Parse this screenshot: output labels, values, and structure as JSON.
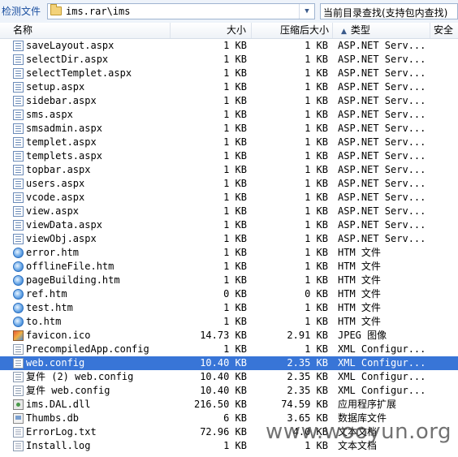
{
  "toolbar": {
    "detect_label": "检测文件",
    "path": "ims.rar\\ims",
    "search_placeholder": "当前目录查找(支持包内查找)"
  },
  "columns": {
    "name": "名称",
    "size": "大小",
    "compressed": "压缩后大小",
    "type": "类型",
    "security": "安全"
  },
  "files": [
    {
      "name": "saveLayout.aspx",
      "size": "1 KB",
      "compressed": "1 KB",
      "type": "ASP.NET Serv...",
      "icon": "aspx-file-icon"
    },
    {
      "name": "selectDir.aspx",
      "size": "1 KB",
      "compressed": "1 KB",
      "type": "ASP.NET Serv...",
      "icon": "aspx-file-icon"
    },
    {
      "name": "selectTemplet.aspx",
      "size": "1 KB",
      "compressed": "1 KB",
      "type": "ASP.NET Serv...",
      "icon": "aspx-file-icon"
    },
    {
      "name": "setup.aspx",
      "size": "1 KB",
      "compressed": "1 KB",
      "type": "ASP.NET Serv...",
      "icon": "aspx-file-icon"
    },
    {
      "name": "sidebar.aspx",
      "size": "1 KB",
      "compressed": "1 KB",
      "type": "ASP.NET Serv...",
      "icon": "aspx-file-icon"
    },
    {
      "name": "sms.aspx",
      "size": "1 KB",
      "compressed": "1 KB",
      "type": "ASP.NET Serv...",
      "icon": "aspx-file-icon"
    },
    {
      "name": "smsadmin.aspx",
      "size": "1 KB",
      "compressed": "1 KB",
      "type": "ASP.NET Serv...",
      "icon": "aspx-file-icon"
    },
    {
      "name": "templet.aspx",
      "size": "1 KB",
      "compressed": "1 KB",
      "type": "ASP.NET Serv...",
      "icon": "aspx-file-icon"
    },
    {
      "name": "templets.aspx",
      "size": "1 KB",
      "compressed": "1 KB",
      "type": "ASP.NET Serv...",
      "icon": "aspx-file-icon"
    },
    {
      "name": "topbar.aspx",
      "size": "1 KB",
      "compressed": "1 KB",
      "type": "ASP.NET Serv...",
      "icon": "aspx-file-icon"
    },
    {
      "name": "users.aspx",
      "size": "1 KB",
      "compressed": "1 KB",
      "type": "ASP.NET Serv...",
      "icon": "aspx-file-icon"
    },
    {
      "name": "vcode.aspx",
      "size": "1 KB",
      "compressed": "1 KB",
      "type": "ASP.NET Serv...",
      "icon": "aspx-file-icon"
    },
    {
      "name": "view.aspx",
      "size": "1 KB",
      "compressed": "1 KB",
      "type": "ASP.NET Serv...",
      "icon": "aspx-file-icon"
    },
    {
      "name": "viewData.aspx",
      "size": "1 KB",
      "compressed": "1 KB",
      "type": "ASP.NET Serv...",
      "icon": "aspx-file-icon"
    },
    {
      "name": "viewObj.aspx",
      "size": "1 KB",
      "compressed": "1 KB",
      "type": "ASP.NET Serv...",
      "icon": "aspx-file-icon"
    },
    {
      "name": "error.htm",
      "size": "1 KB",
      "compressed": "1 KB",
      "type": "HTM 文件",
      "icon": "htm-file-icon"
    },
    {
      "name": "offlineFile.htm",
      "size": "1 KB",
      "compressed": "1 KB",
      "type": "HTM 文件",
      "icon": "htm-file-icon"
    },
    {
      "name": "pageBuilding.htm",
      "size": "1 KB",
      "compressed": "1 KB",
      "type": "HTM 文件",
      "icon": "htm-file-icon"
    },
    {
      "name": "ref.htm",
      "size": "0 KB",
      "compressed": "0 KB",
      "type": "HTM 文件",
      "icon": "htm-file-icon"
    },
    {
      "name": "test.htm",
      "size": "1 KB",
      "compressed": "1 KB",
      "type": "HTM 文件",
      "icon": "htm-file-icon"
    },
    {
      "name": "to.htm",
      "size": "1 KB",
      "compressed": "1 KB",
      "type": "HTM 文件",
      "icon": "htm-file-icon"
    },
    {
      "name": "favicon.ico",
      "size": "14.73 KB",
      "compressed": "2.91 KB",
      "type": "JPEG 图像",
      "icon": "ico-file-icon"
    },
    {
      "name": "PrecompiledApp.config",
      "size": "1 KB",
      "compressed": "1 KB",
      "type": "XML Configur...",
      "icon": "config-file-icon"
    },
    {
      "name": "web.config",
      "size": "10.40 KB",
      "compressed": "2.35 KB",
      "type": "XML Configur...",
      "icon": "config-file-icon",
      "selected": true
    },
    {
      "name": "复件 (2) web.config",
      "size": "10.40 KB",
      "compressed": "2.35 KB",
      "type": "XML Configur...",
      "icon": "config-file-icon"
    },
    {
      "name": "复件 web.config",
      "size": "10.40 KB",
      "compressed": "2.35 KB",
      "type": "XML Configur...",
      "icon": "config-file-icon"
    },
    {
      "name": "ims.DAL.dll",
      "size": "216.50 KB",
      "compressed": "74.59 KB",
      "type": "应用程序扩展",
      "icon": "dll-file-icon"
    },
    {
      "name": "Thumbs.db",
      "size": "6 KB",
      "compressed": "3.65 KB",
      "type": "数据库文件",
      "icon": "db-file-icon"
    },
    {
      "name": "ErrorLog.txt",
      "size": "72.96 KB",
      "compressed": "4.0 KB",
      "type": "文本文档",
      "icon": "txt-file-icon"
    },
    {
      "name": "Install.log",
      "size": "1 KB",
      "compressed": "1 KB",
      "type": "文本文档",
      "icon": "txt-file-icon"
    }
  ],
  "watermark": {
    "text": "www.wooyun.org"
  },
  "colors": {
    "selection": "#3875d7",
    "toolbar_bg": "#eef3fa"
  }
}
